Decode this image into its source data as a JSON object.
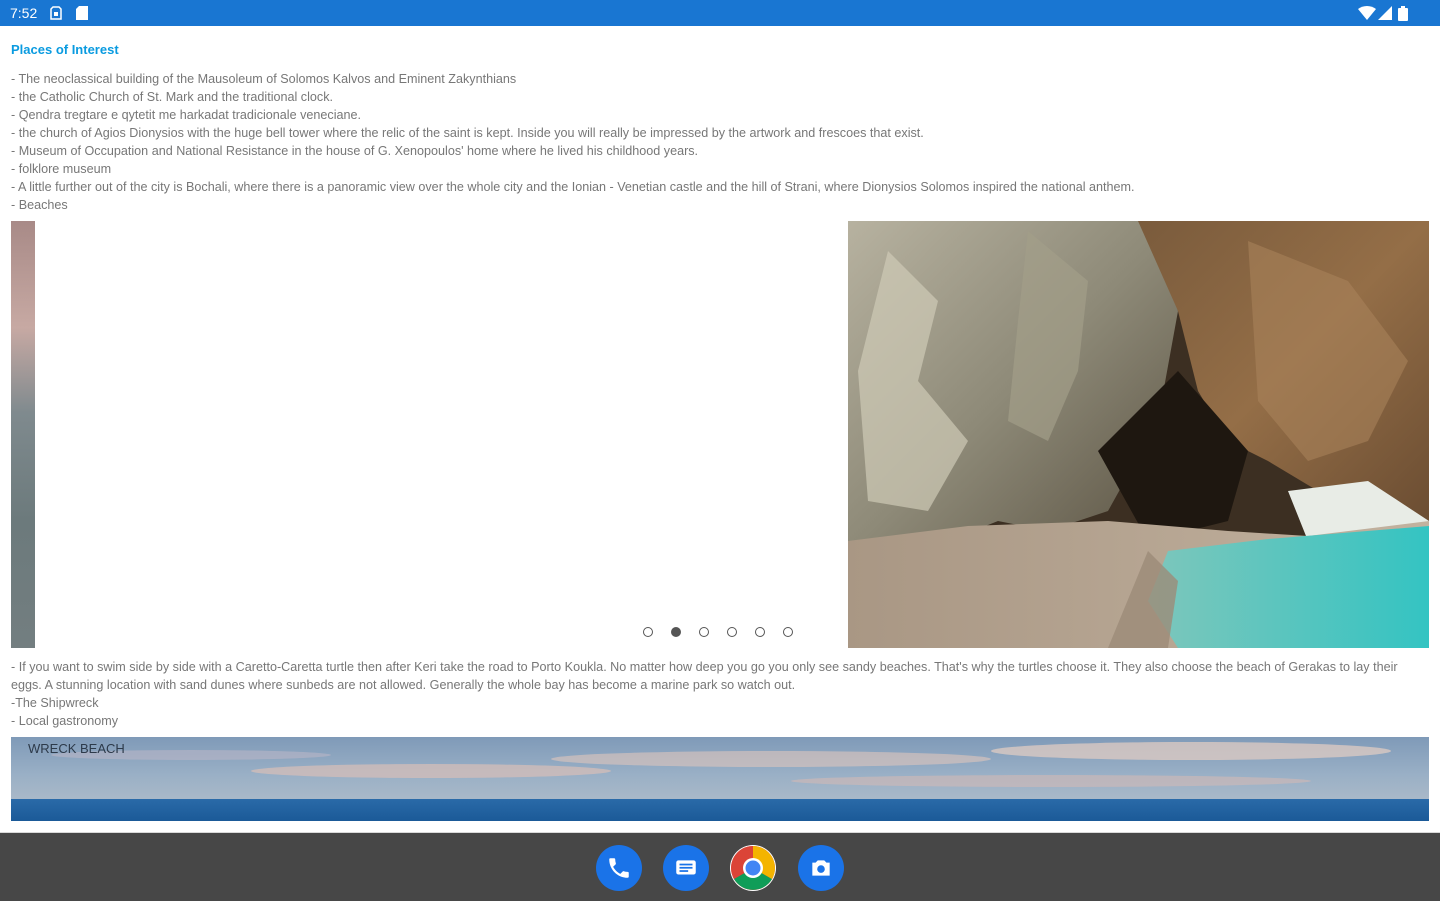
{
  "status_bar": {
    "time": "7:52",
    "left_icons": [
      "sim-card-icon",
      "sd-card-icon"
    ],
    "right_icons": [
      "wifi-icon",
      "signal-icon",
      "battery-icon"
    ],
    "color": "#1976d2"
  },
  "section": {
    "title": "Places of Interest",
    "title_color": "#0a9be0"
  },
  "places_lines": [
    "- The neoclassical building of the Mausoleum of Solomos Kalvos and Eminent Zakynthians",
    "- the Catholic Church of St. Mark and the traditional clock.",
    "- Qendra tregtare e qytetit me harkadat tradicionale veneciane.",
    "-  the church of Agios Dionysios with the huge bell tower where the relic of the saint is kept. Inside you will really be impressed by the artwork and frescoes that exist.",
    "- Museum of Occupation and National Resistance in the house of G. Xenopoulos' home where he lived his childhood years.",
    "- folklore museum",
    "- A little further out of the city is Bochali, where there is a panoramic view over the whole city and the Ionian - Venetian castle and the hill of Strani, where Dionysios Solomos inspired the national anthem.",
    "- Beaches"
  ],
  "carousel": {
    "slide_count": 6,
    "active_index": 1
  },
  "beach_lines": [
    "- If you want to swim side by side with a Caretto-Caretta turtle then after Keri take the road to Porto Koukla. No matter how deep you go you only see sandy beaches. That's why the turtles choose it. They also choose the beach of Gerakas to lay their eggs. A stunning location with sand dunes where sunbeds are not allowed. Generally the whole bay has become a marine park so watch out.",
    "-The Shipwreck",
    "- Local gastronomy"
  ],
  "banner": {
    "label": "WRECK BEACH"
  },
  "dock": {
    "apps": [
      "phone-app-icon",
      "messages-app-icon",
      "chrome-app-icon",
      "camera-app-icon"
    ],
    "background": "#474747"
  }
}
